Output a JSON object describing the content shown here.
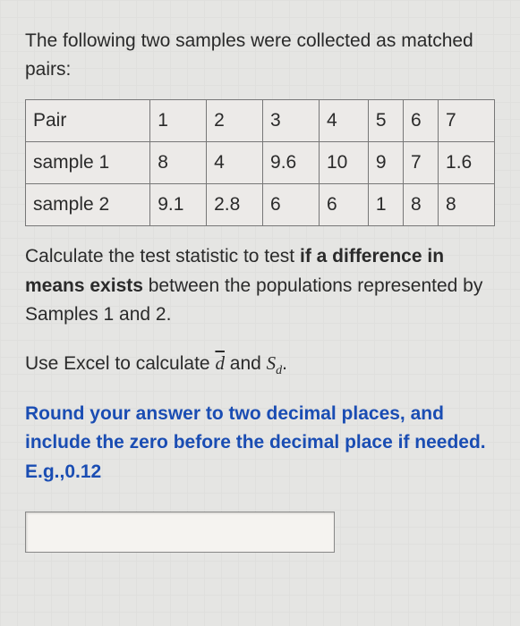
{
  "intro": "The following two samples were collected as matched pairs:",
  "table": {
    "row1": {
      "h": "Pair",
      "c1": "1",
      "c2": "2",
      "c3": "3",
      "c4": "4",
      "c5": "5",
      "c6": "6",
      "c7": "7"
    },
    "row2": {
      "h": "sample 1",
      "c1": "8",
      "c2": "4",
      "c3": "9.6",
      "c4": "10",
      "c5": "9",
      "c6": "7",
      "c7": "1.6"
    },
    "row3": {
      "h": "sample 2",
      "c1": "9.1",
      "c2": "2.8",
      "c3": "6",
      "c4": "6",
      "c5": "1",
      "c6": "8",
      "c7": "8"
    }
  },
  "question_parts": {
    "p1": "Calculate the test statistic to test ",
    "bold": "if a difference in means exists",
    "p2": " between the populations represented by Samples 1 and 2."
  },
  "excel_parts": {
    "p1": "Use Excel to calculate ",
    "dbar": "d",
    "mid": " and ",
    "sd": "S",
    "sd_sub": "d",
    "end": "."
  },
  "instruction": "Round your answer to two decimal places, and include the zero before the decimal place if needed. E.g.,0.12"
}
